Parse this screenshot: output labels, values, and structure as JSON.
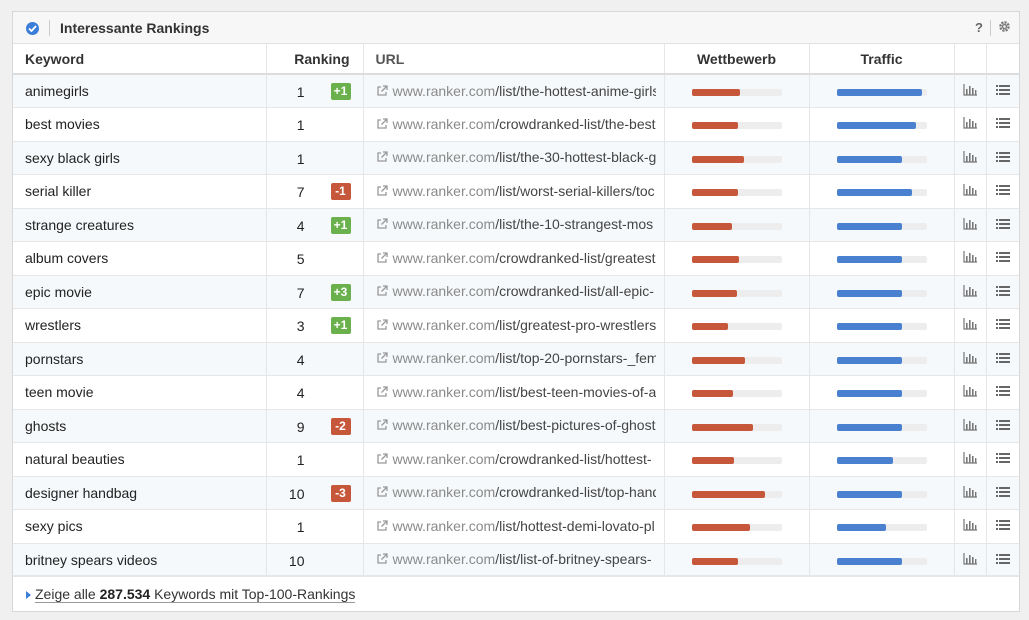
{
  "panel": {
    "title": "Interessante Rankings",
    "help_label": "?",
    "accent": "#3b7dd8"
  },
  "columns": {
    "keyword": "Keyword",
    "ranking": "Ranking",
    "url": "URL",
    "competition": "Wettbewerb",
    "traffic": "Traffic"
  },
  "colors": {
    "competition_bar": "#c7573a",
    "traffic_bar": "#4a80d0",
    "badge_up": "#6ab04c",
    "badge_down": "#c7573a"
  },
  "rows": [
    {
      "keyword": "animegirls",
      "rank": "1",
      "change": "+1",
      "dir": "up",
      "domain": "www.ranker.com",
      "path": "/list/the-hottest-anime-girls",
      "competition": 0.54,
      "traffic": 0.95
    },
    {
      "keyword": "best movies",
      "rank": "1",
      "change": "",
      "dir": "",
      "domain": "www.ranker.com",
      "path": "/crowdranked-list/the-best",
      "competition": 0.52,
      "traffic": 0.88
    },
    {
      "keyword": "sexy black girls",
      "rank": "1",
      "change": "",
      "dir": "",
      "domain": "www.ranker.com",
      "path": "/list/the-30-hottest-black-g",
      "competition": 0.58,
      "traffic": 0.73
    },
    {
      "keyword": "serial killer",
      "rank": "7",
      "change": "-1",
      "dir": "down",
      "domain": "www.ranker.com",
      "path": "/list/worst-serial-killers/toc",
      "competition": 0.52,
      "traffic": 0.84
    },
    {
      "keyword": "strange creatures",
      "rank": "4",
      "change": "+1",
      "dir": "up",
      "domain": "www.ranker.com",
      "path": "/list/the-10-strangest-mos",
      "competition": 0.45,
      "traffic": 0.73
    },
    {
      "keyword": "album covers",
      "rank": "5",
      "change": "",
      "dir": "",
      "domain": "www.ranker.com",
      "path": "/crowdranked-list/greatest",
      "competition": 0.53,
      "traffic": 0.73
    },
    {
      "keyword": "epic movie",
      "rank": "7",
      "change": "+3",
      "dir": "up",
      "domain": "www.ranker.com",
      "path": "/crowdranked-list/all-epic-",
      "competition": 0.51,
      "traffic": 0.73
    },
    {
      "keyword": "wrestlers",
      "rank": "3",
      "change": "+1",
      "dir": "up",
      "domain": "www.ranker.com",
      "path": "/list/greatest-pro-wrestlers",
      "competition": 0.4,
      "traffic": 0.73
    },
    {
      "keyword": "pornstars",
      "rank": "4",
      "change": "",
      "dir": "",
      "domain": "www.ranker.com",
      "path": "/list/top-20-pornstars-_fem",
      "competition": 0.59,
      "traffic": 0.73
    },
    {
      "keyword": "teen movie",
      "rank": "4",
      "change": "",
      "dir": "",
      "domain": "www.ranker.com",
      "path": "/list/best-teen-movies-of-a",
      "competition": 0.46,
      "traffic": 0.73
    },
    {
      "keyword": "ghosts",
      "rank": "9",
      "change": "-2",
      "dir": "down",
      "domain": "www.ranker.com",
      "path": "/list/best-pictures-of-ghost",
      "competition": 0.68,
      "traffic": 0.73
    },
    {
      "keyword": "natural beauties",
      "rank": "1",
      "change": "",
      "dir": "",
      "domain": "www.ranker.com",
      "path": "/crowdranked-list/hottest-",
      "competition": 0.47,
      "traffic": 0.63
    },
    {
      "keyword": "designer handbag",
      "rank": "10",
      "change": "-3",
      "dir": "down",
      "domain": "www.ranker.com",
      "path": "/crowdranked-list/top-hand",
      "competition": 0.82,
      "traffic": 0.73
    },
    {
      "keyword": "sexy pics",
      "rank": "1",
      "change": "",
      "dir": "",
      "domain": "www.ranker.com",
      "path": "/list/hottest-demi-lovato-pl",
      "competition": 0.65,
      "traffic": 0.55
    },
    {
      "keyword": "britney spears videos",
      "rank": "10",
      "change": "",
      "dir": "",
      "domain": "www.ranker.com",
      "path": "/list/list-of-britney-spears-",
      "competition": 0.52,
      "traffic": 0.73
    }
  ],
  "footer": {
    "prefix": "Zeige alle",
    "count": "287.534",
    "suffix": "Keywords mit Top-100-Rankings"
  }
}
